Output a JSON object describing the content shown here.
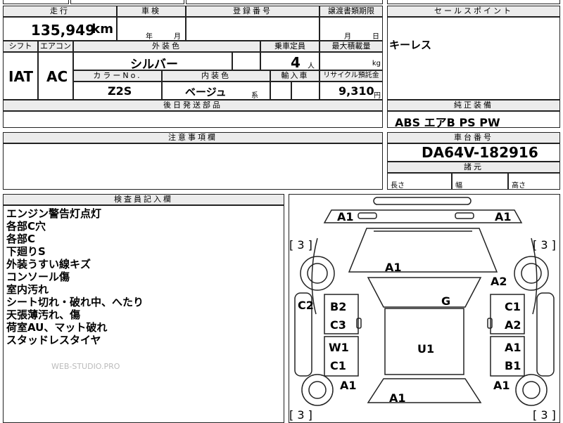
{
  "top_partial": "",
  "mileage": {
    "label": "走行",
    "value": "135,949",
    "unit": "km"
  },
  "inspection": {
    "label": "車検",
    "year": "年",
    "month": "月"
  },
  "registration": {
    "label": "登録番号",
    "value": ""
  },
  "transfer": {
    "label": "譲渡書類期限",
    "month": "月",
    "day": "日"
  },
  "sales_points": {
    "label": "セールスポイント",
    "text": "キーレス"
  },
  "shift": {
    "label": "シフト",
    "value": "IAT"
  },
  "aircon": {
    "label": "エアコン",
    "value": "AC"
  },
  "exterior": {
    "label": "外装色",
    "value": "シルバー"
  },
  "capacity": {
    "label": "乗車定員",
    "value": "4",
    "unit": "人"
  },
  "max_load": {
    "label": "最大積載量",
    "unit": "kg"
  },
  "color_no": {
    "label": "カラーNo.",
    "value": "Z2S"
  },
  "interior": {
    "label": "内装色",
    "value": "ベージュ",
    "suffix": "系"
  },
  "import": {
    "label": "輸入車"
  },
  "recycle": {
    "label": "リサイクル預託金",
    "value": "9,310",
    "unit": "円"
  },
  "later_parts": {
    "label": "後日発送部品"
  },
  "genuine_equipment": {
    "label": "純正装備",
    "value": "ABS エアB PS PW"
  },
  "notes": {
    "label": "注意事項欄"
  },
  "chassis": {
    "label": "車台番号",
    "value": "DA64V-182916"
  },
  "specs": {
    "label": "諸元",
    "length": "長さ",
    "width": "幅",
    "height": "高さ"
  },
  "inspector": {
    "label": "検査員記入欄",
    "lines": [
      "エンジン警告灯点灯",
      "各部C穴",
      "各部C",
      "下廻りS",
      "外装うすい線キズ",
      "コンソール傷",
      "室内汚れ",
      "シート切れ・破れ中、へたり",
      "天張薄汚れ、傷",
      "荷室AU、マット破れ",
      "スタッドレスタイヤ"
    ],
    "watermark": "WEB-STUDIO.PRO"
  },
  "diagram": {
    "marks": {
      "top_left": "A1",
      "top_right": "A1",
      "tire_left_top": "[ 3 ]",
      "tire_right_top": "[ 3 ]",
      "hood": "A1",
      "fender_right": "A2",
      "left_c2": "C2",
      "b2": "B2",
      "c3": "C3",
      "g": "G",
      "c1_r": "C1",
      "a2_r": "A2",
      "w1": "W1",
      "c1_l": "C1",
      "u1": "U1",
      "a1_r": "A1",
      "b1_r": "B1",
      "a1_rear_l": "A1",
      "a1_rear_r": "A1",
      "a1_bottom": "A1",
      "tire_left_bottom": "[ 3 ]",
      "tire_right_bottom": "[ 3 ]"
    }
  }
}
